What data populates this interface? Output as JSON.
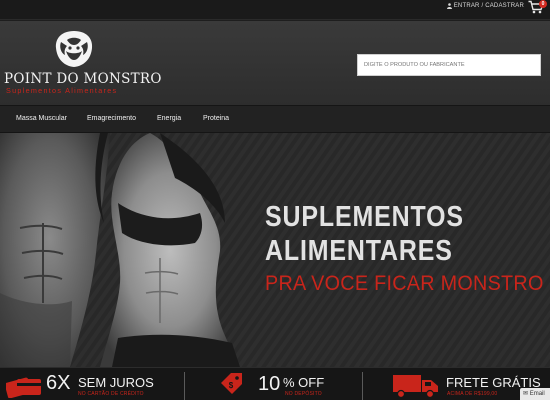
{
  "topbar": {
    "login_label": "ENTRAR / CADASTRAR",
    "cart_count": "0"
  },
  "header": {
    "brand": "POINT DO MONSTRO",
    "tagline": "Suplementos Alimentares",
    "search_placeholder": "DIGITE O PRODUTO OU FABRICANTE"
  },
  "nav": {
    "items": [
      "Massa Muscular",
      "Emagrecimento",
      "Energia",
      "Proteina"
    ]
  },
  "hero": {
    "title_line1": "SUPLEMENTOS",
    "title_line2": "ALIMENTARES",
    "subtitle": "PRA VOCE FICAR MONSTRO"
  },
  "benefits": [
    {
      "big1": "6X",
      "big2": "SEM JUROS",
      "small": "NO CARTÃO DE CRÉDITO",
      "icon": "credit-card-icon"
    },
    {
      "big1": "10",
      "big2": "% OFF",
      "small": "NO DEPÓSITO",
      "icon": "price-tag-icon"
    },
    {
      "big1": "FRETE GRÁTIS",
      "small": "ACIMA DE R$199,00",
      "icon": "delivery-truck-icon"
    }
  ],
  "email_tab": "Email",
  "colors": {
    "accent": "#c9251b",
    "dark": "#1e1e1e",
    "header": "#353535"
  }
}
